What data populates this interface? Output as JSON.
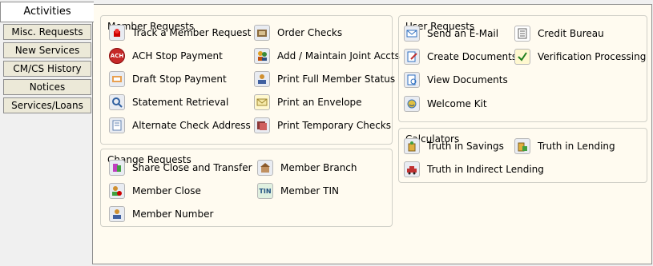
{
  "tabs": [
    "Activities",
    "Misc. Requests",
    "New Services",
    "CM/CS History",
    "Notices",
    "Services/Loans"
  ],
  "groups": {
    "member_requests": {
      "title": "Member Requests",
      "items": [
        "Track a Member Request",
        "ACH Stop Payment",
        "Draft Stop Payment",
        "Statement Retrieval",
        "Alternate Check Address",
        "Order Checks",
        "Add / Maintain Joint Accts",
        "Print Full Member Status",
        "Print an Envelope",
        "Print Temporary Checks"
      ]
    },
    "change_requests": {
      "title": "Change Requests",
      "items": [
        "Share Close and Transfer",
        "Member Close",
        "Member Number",
        "Member Branch",
        "Member TIN"
      ]
    },
    "user_requests": {
      "title": "User Requests",
      "items": [
        "Send an E-Mail",
        "Create Documents",
        "View Documents",
        "Welcome Kit",
        "Credit Bureau",
        "Verification Processing"
      ]
    },
    "calculators": {
      "title": "Calculators",
      "items": [
        "Truth in Savings",
        "Truth in Indirect Lending",
        "Truth in Lending"
      ]
    }
  },
  "icon_text": {
    "ach": "ACH",
    "tin": "TIN"
  },
  "colors": {
    "panel_bg": "#fffbf0",
    "tab_bg": "#ece9d8",
    "border": "#8e8e8e"
  }
}
